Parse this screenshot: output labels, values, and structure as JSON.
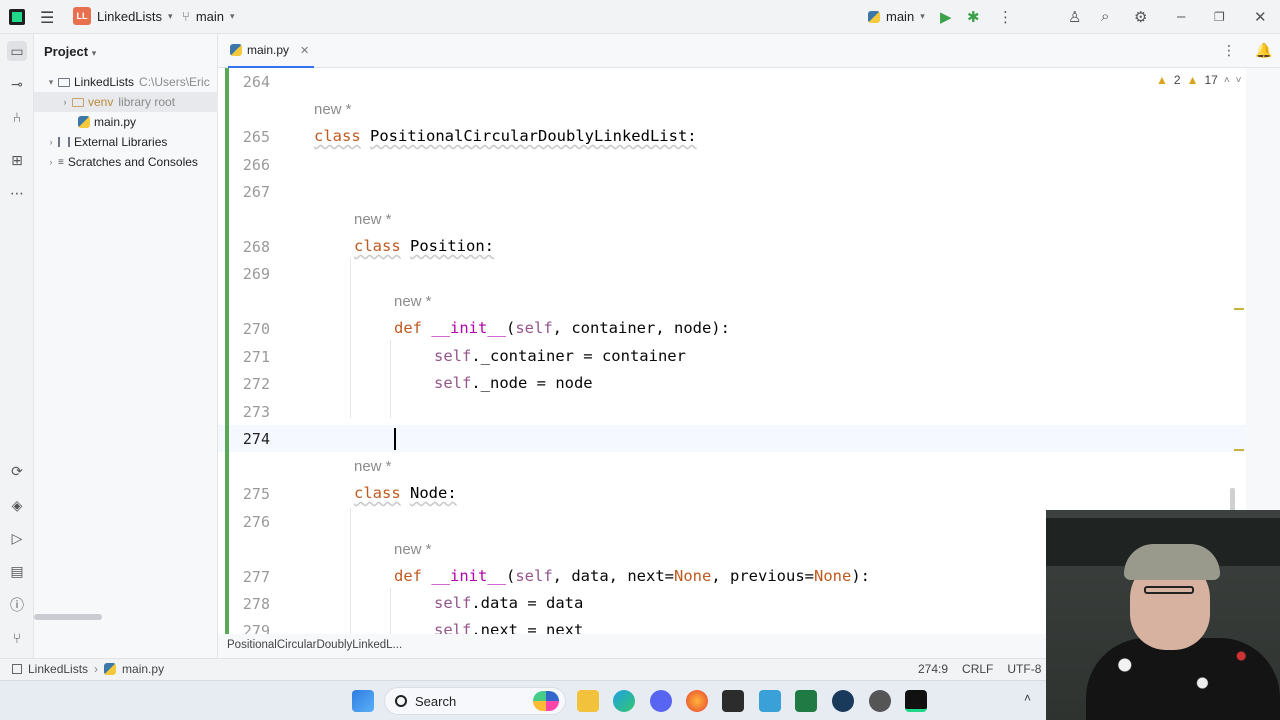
{
  "titlebar": {
    "project_badge": "LL",
    "project_name": "LinkedLists",
    "branch": "main",
    "run_config": "main"
  },
  "project_panel": {
    "title": "Project",
    "tree": [
      {
        "label": "LinkedLists",
        "hint": "C:\\Users\\Eric"
      },
      {
        "label": "venv",
        "hint": "library root"
      },
      {
        "label": "main.py"
      },
      {
        "label": "External Libraries"
      },
      {
        "label": "Scratches and Consoles"
      }
    ]
  },
  "editor": {
    "tab_label": "main.py",
    "inspection": {
      "warnings": "2",
      "weak_warnings": "17"
    },
    "lines": [
      {
        "n": "264"
      },
      {
        "n": "265"
      },
      {
        "n": "266"
      },
      {
        "n": "267"
      },
      {
        "n": "268"
      },
      {
        "n": "269"
      },
      {
        "n": "270"
      },
      {
        "n": "271"
      },
      {
        "n": "272"
      },
      {
        "n": "273"
      },
      {
        "n": "274"
      },
      {
        "n": "275"
      },
      {
        "n": "276"
      },
      {
        "n": "277"
      },
      {
        "n": "278"
      },
      {
        "n": "279"
      }
    ],
    "hint": "new *",
    "code": {
      "l265_kw": "class",
      "l265_name": "PositionalCircularDoublyLinkedList:",
      "l268_kw": "class",
      "l268_name": "Position:",
      "l270_def": "def",
      "l270_dunder": "__init__",
      "l270_open": "(",
      "l270_self": "self",
      "l270_rest": ", container, node):",
      "l271_self": "self",
      "l271_rest": "._container = container",
      "l272_self": "self",
      "l272_rest": "._node = node",
      "l275_kw": "class",
      "l275_name": "Node:",
      "l277_def": "def",
      "l277_dunder": "__init__",
      "l277_open": "(",
      "l277_self": "self",
      "l277_mid1": ", data, next=",
      "l277_none1": "None",
      "l277_mid2": ", previous=",
      "l277_none2": "None",
      "l277_end": "):",
      "l278_self": "self",
      "l278_rest": ".data = data",
      "l279_self": "self",
      "l279_rest": ".next = next"
    },
    "breadcrumb": "PositionalCircularDoublyLinkedL..."
  },
  "statusbar": {
    "project": "LinkedLists",
    "file": "main.py",
    "position": "274:9",
    "line_sep": "CRLF",
    "encoding": "UTF-8"
  },
  "taskbar": {
    "search_label": "Search"
  }
}
